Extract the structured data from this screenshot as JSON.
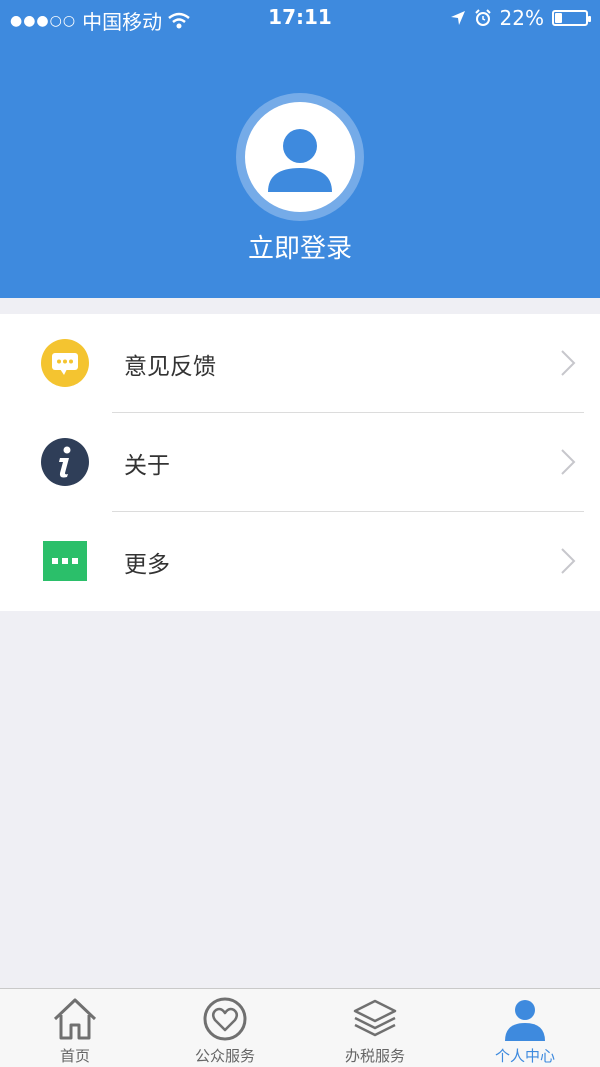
{
  "status_bar": {
    "carrier": "中国移动",
    "time": "17:11",
    "battery_percent": "22%",
    "battery_level": 0.22
  },
  "profile": {
    "login_label": "立即登录"
  },
  "menu": {
    "items": [
      {
        "label": "意见反馈",
        "icon": "feedback-bubble-icon",
        "icon_color": "#f4c430"
      },
      {
        "label": "关于",
        "icon": "info-icon",
        "icon_color": "#2f3e58"
      },
      {
        "label": "更多",
        "icon": "more-dots-icon",
        "icon_color": "#2bbf6a"
      }
    ]
  },
  "tabbar": {
    "tabs": [
      {
        "label": "首页",
        "icon": "home-icon",
        "active": false
      },
      {
        "label": "公众服务",
        "icon": "heart-service-icon",
        "active": false
      },
      {
        "label": "办税服务",
        "icon": "layers-icon",
        "active": false
      },
      {
        "label": "个人中心",
        "icon": "person-icon",
        "active": true
      }
    ]
  },
  "colors": {
    "brand_blue": "#3e8ade",
    "background": "#efeff4"
  }
}
